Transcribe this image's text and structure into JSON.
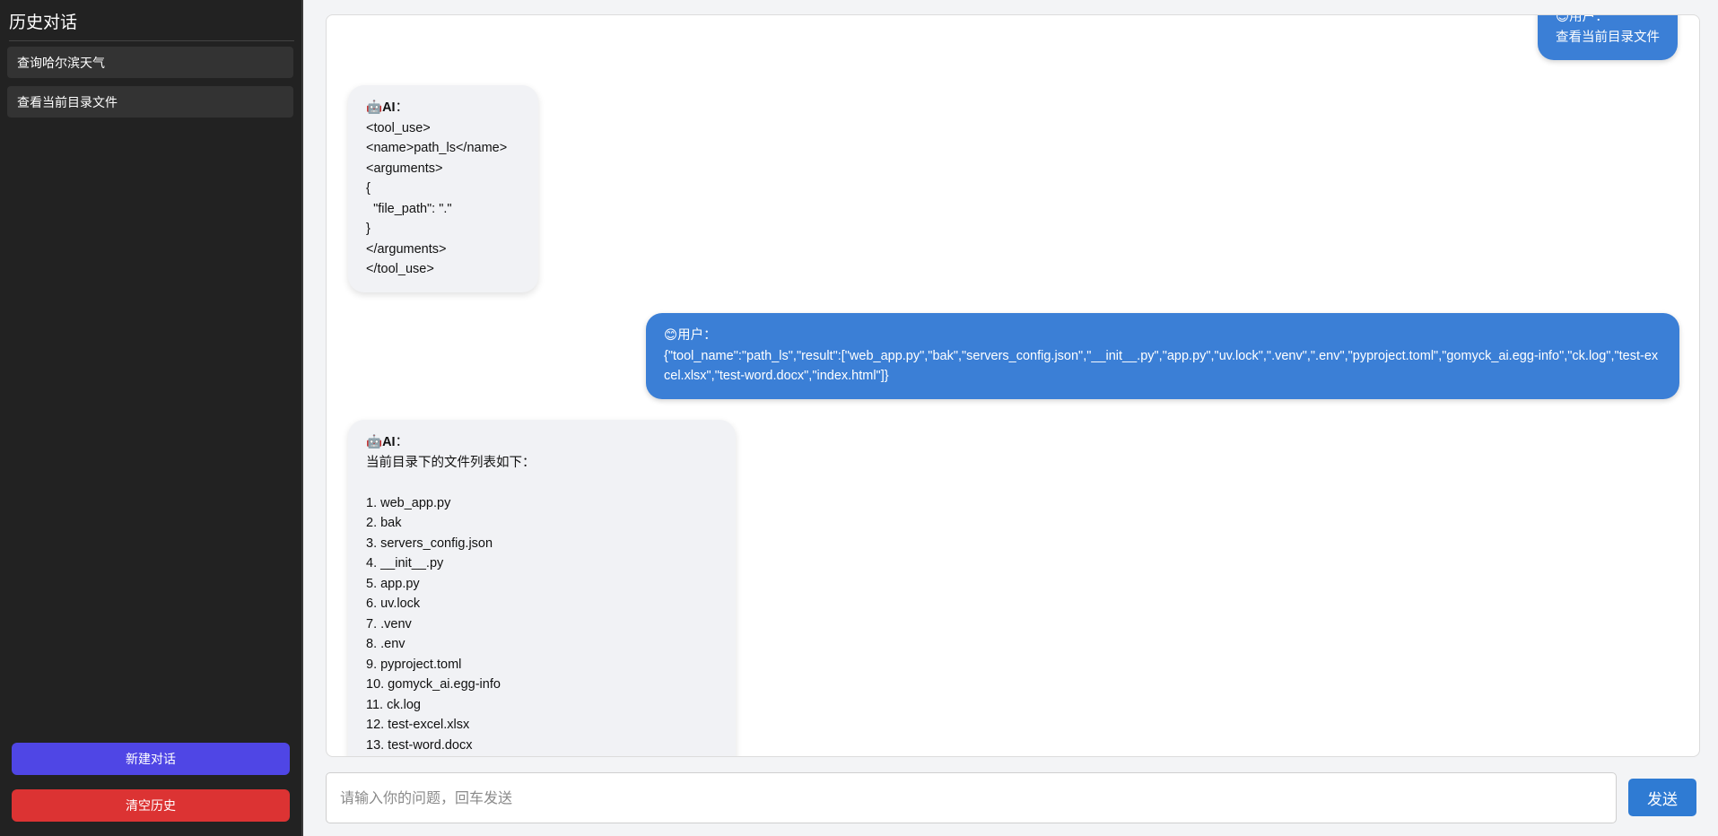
{
  "sidebar": {
    "title": "历史对话",
    "history": [
      "查询哈尔滨天气",
      "查看当前目录文件"
    ],
    "new_chat_label": "新建对话",
    "clear_history_label": "清空历史"
  },
  "messages": [
    {
      "role": "user",
      "emoji": "😊",
      "speaker": "用户",
      "text": "查看当前目录文件"
    },
    {
      "role": "ai",
      "emoji": "🤖",
      "speaker": "AI",
      "text": "<tool_use>\n<name>path_ls</name>\n<arguments>\n{\n  \"file_path\": \".\"\n}\n</arguments>\n</tool_use>"
    },
    {
      "role": "user",
      "emoji": "😊",
      "speaker": "用户",
      "text": "{\"tool_name\":\"path_ls\",\"result\":[\"web_app.py\",\"bak\",\"servers_config.json\",\"__init__.py\",\"app.py\",\"uv.lock\",\".venv\",\".env\",\"pyproject.toml\",\"gomyck_ai.egg-info\",\"ck.log\",\"test-excel.xlsx\",\"test-word.docx\",\"index.html\"]}"
    },
    {
      "role": "ai",
      "emoji": "🤖",
      "speaker": "AI",
      "text": "当前目录下的文件列表如下：\n\n1. web_app.py\n2. bak\n3. servers_config.json\n4. __init__.py\n5. app.py\n6. uv.lock\n7. .venv\n8. .env\n9. pyproject.toml\n10. gomyck_ai.egg-info\n11. ck.log\n12. test-excel.xlsx\n13. test-word.docx"
    }
  ],
  "input": {
    "placeholder": "请输入你的问题，回车发送",
    "value": ""
  },
  "send_label": "发送",
  "colors": {
    "sidebar_bg": "#222222",
    "user_bubble": "#3b7fd6",
    "ai_bubble": "#f1f2f5",
    "new_chat": "#4f46e5",
    "clear_history": "#dc3333",
    "send": "#2f7bd3"
  }
}
